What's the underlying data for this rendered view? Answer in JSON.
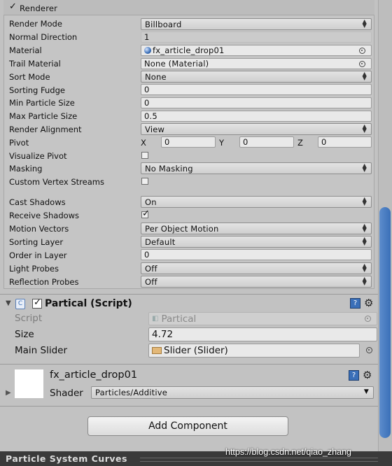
{
  "renderer": {
    "header_label": "Renderer",
    "rows": [
      {
        "label": "Render Mode",
        "value": "Billboard"
      },
      {
        "label": "Normal Direction",
        "value": "1"
      },
      {
        "label": "Material",
        "value": "fx_article_drop01"
      },
      {
        "label": "Trail Material",
        "value": "None (Material)"
      },
      {
        "label": "Sort Mode",
        "value": "None"
      },
      {
        "label": "Sorting Fudge",
        "value": "0"
      },
      {
        "label": "Min Particle Size",
        "value": "0"
      },
      {
        "label": "Max Particle Size",
        "value": "0.5"
      },
      {
        "label": "Render Alignment",
        "value": "View"
      },
      {
        "label": "Pivot",
        "x_label": "X",
        "x": "0",
        "y_label": "Y",
        "y": "0",
        "z_label": "Z",
        "z": "0"
      },
      {
        "label": "Visualize Pivot"
      },
      {
        "label": "Masking",
        "value": "No Masking"
      },
      {
        "label": "Custom Vertex Streams"
      },
      {
        "label": "Cast Shadows",
        "value": "On"
      },
      {
        "label": "Receive Shadows"
      },
      {
        "label": "Motion Vectors",
        "value": "Per Object Motion"
      },
      {
        "label": "Sorting Layer",
        "value": "Default"
      },
      {
        "label": "Order in Layer",
        "value": "0"
      },
      {
        "label": "Light Probes",
        "value": "Off"
      },
      {
        "label": "Reflection Probes",
        "value": "Off"
      }
    ]
  },
  "partical": {
    "title": "Partical (Script)",
    "script_label": "Script",
    "script_value": "Partical",
    "size_label": "Size",
    "size_value": "4.72",
    "slider_label": "Main Slider",
    "slider_value": "Slider (Slider)"
  },
  "material_panel": {
    "name": "fx_article_drop01",
    "shader_label": "Shader",
    "shader_value": "Particles/Additive"
  },
  "add_component_label": "Add Component",
  "footer_title": "Particle System Curves",
  "watermark": "https://blog.csdn.net/qiao_zhang",
  "colors": {
    "accent": "#3a6fb8",
    "panel": "#c2c2c2",
    "field": "#e9e9e9",
    "footer": "#3a3a3a"
  }
}
